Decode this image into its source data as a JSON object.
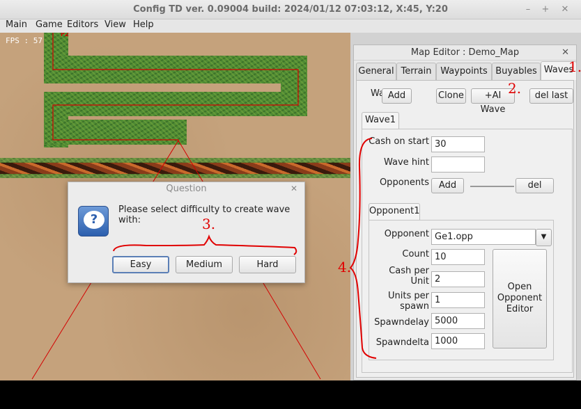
{
  "window": {
    "title": "Config TD ver. 0.09004 build: 2024/01/12  07:03:12, X:45, Y:20",
    "controls": [
      "–",
      "+",
      "✕"
    ]
  },
  "menu": [
    "Main",
    "Game",
    "Editors",
    "View",
    "Help"
  ],
  "game": {
    "fps_label": "FPS : 57",
    "player_marker": "P2"
  },
  "editor": {
    "title": "Map Editor : Demo_Map",
    "close": "✕",
    "tabs": [
      "General",
      "Terrain",
      "Waypoints",
      "Buyables",
      "Waves"
    ],
    "active_tab": "Waves",
    "waves_label": "Waves",
    "buttons": {
      "add": "Add",
      "clone": "Clone",
      "ai_wave": "+AI Wave",
      "del_last": "del last"
    },
    "wave_tab": "Wave1",
    "cash_on_start_label": "Cash on start",
    "cash_on_start_value": "30",
    "wave_hint_label": "Wave hint",
    "wave_hint_value": "",
    "opponents_label": "Opponents",
    "opponents_add": "Add",
    "opponents_del": "del",
    "opponent_tab": "Opponent1",
    "opponent_label": "Opponent",
    "opponent_value": "Ge1.opp",
    "count_label": "Count",
    "count_value": "10",
    "cash_per_unit_label_1": "Cash per",
    "cash_per_unit_label_2": "Unit",
    "cash_per_unit_value": "2",
    "units_per_spawn_label_1": "Units per",
    "units_per_spawn_label_2": "spawn",
    "units_per_spawn_value": "1",
    "spawndelay_label": "Spawndelay",
    "spawndelay_value": "5000",
    "spawndelta_label": "Spawndelta",
    "spawndelta_value": "1000",
    "open_editor_1": "Open",
    "open_editor_2": "Opponent",
    "open_editor_3": "Editor"
  },
  "dialog": {
    "title": "Question",
    "close": "✕",
    "message": "Please select difficulty to create wave with:",
    "buttons": [
      "Easy",
      "Medium",
      "Hard"
    ]
  },
  "annotations": [
    "1.",
    "2.",
    "3.",
    "4."
  ],
  "colors": {
    "annotation": "#e00000",
    "grass": "#4f8a34",
    "sand": "#c5a27c"
  }
}
